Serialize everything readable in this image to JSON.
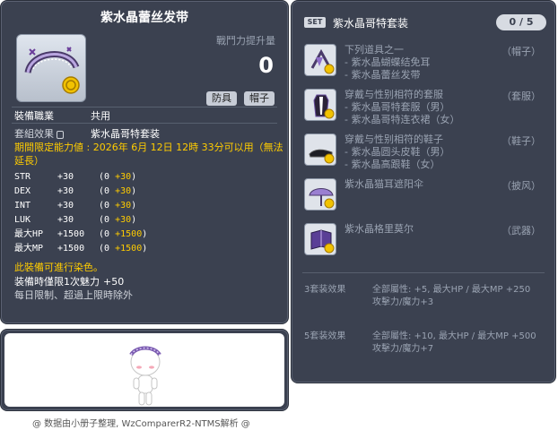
{
  "item_id": "01006971",
  "item": {
    "name": "紫水晶蕾丝发带",
    "power_label": "戰鬥力提升量",
    "power_value": "0",
    "tag_type": "防具",
    "tag_slot": "帽子",
    "job_label": "裝備職業",
    "job_value": "共用",
    "set_label": "套組效果",
    "set_value": "紫水晶哥特套装",
    "expire": "期間限定能力値 : 2026年 6月 12日 12時 33分可以用（無法延長）",
    "stats": [
      {
        "name": "STR",
        "base": "+30",
        "open": "(0",
        "bonus": "+30",
        "close": ")"
      },
      {
        "name": "DEX",
        "base": "+30",
        "open": "(0",
        "bonus": "+30",
        "close": ")"
      },
      {
        "name": "INT",
        "base": "+30",
        "open": "(0",
        "bonus": "+30",
        "close": ")"
      },
      {
        "name": "LUK",
        "base": "+30",
        "open": "(0",
        "bonus": "+30",
        "close": ")"
      },
      {
        "name": "最大HP",
        "base": "+1500",
        "open": "(0",
        "bonus": "+1500",
        "close": ")"
      },
      {
        "name": "最大MP",
        "base": "+1500",
        "open": "(0",
        "bonus": "+1500",
        "close": ")"
      }
    ],
    "dye": "此裝備可進行染色。",
    "charm_label": "装備時僅限1次魅力",
    "charm_value": "+50",
    "no_limit": "每日限制、超過上限時除外"
  },
  "footer": "@ 数据由小册子整理, WzComparerR2-NTMS解析 @",
  "set": {
    "badge": "SET",
    "name": "紫水晶哥特套装",
    "count": "0 / 5",
    "items": [
      {
        "lines": [
          "下列道具之一",
          "- 紫水晶蝴蝶结免耳",
          "- 紫水晶蕾丝发带"
        ],
        "slot": "（帽子）",
        "icon": "ribbon-icon"
      },
      {
        "lines": [
          "穿戴与性别相符的套服",
          "- 紫水晶哥特套服（男）",
          "- 紫水晶哥特连衣裙（女）"
        ],
        "slot": "（套服）",
        "icon": "outfit-icon"
      },
      {
        "lines": [
          "穿戴与性别相符的鞋子",
          "- 紫水晶圆头皮鞋（男）",
          "- 紫水晶高跟鞋（女）"
        ],
        "slot": "（鞋子）",
        "icon": "shoes-icon"
      },
      {
        "lines": [
          "紫水晶猫耳遮阳伞"
        ],
        "slot": "（披风）",
        "icon": "umbrella-icon"
      },
      {
        "lines": [
          "紫水晶格里莫尔"
        ],
        "slot": "（武器）",
        "icon": "grimoire-icon"
      }
    ],
    "effects": [
      {
        "label": "3套装效果",
        "stats": "全部屬性: +5, 最大HP / 最大MP  +250",
        "atk": "攻擊力/魔力+3"
      },
      {
        "label": "5套装效果",
        "stats": "全部屬性: +10, 最大HP / 最大MP  +500",
        "atk": "攻擊力/魔力+7"
      }
    ]
  },
  "colors": {
    "panel_bg": "#3b4150",
    "highlight": "#ffcc00",
    "muted": "#9aa3b2"
  }
}
